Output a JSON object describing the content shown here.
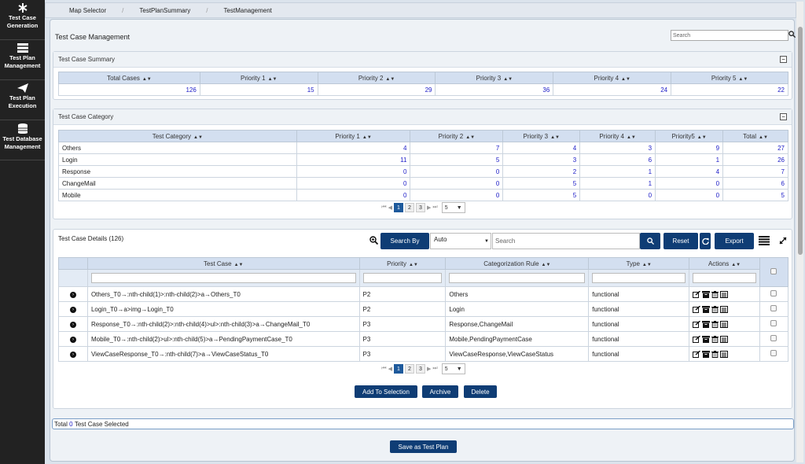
{
  "sidebar": {
    "items": [
      {
        "label": "Test Case Generation",
        "icon": "asterisk-icon"
      },
      {
        "label": "Test Plan Management",
        "icon": "server-stack-icon"
      },
      {
        "label": "Test Plan Execution",
        "icon": "paper-plane-icon"
      },
      {
        "label": "Test Database Management",
        "icon": "database-icon"
      }
    ]
  },
  "breadcrumb": [
    "Map Selector",
    "TestPlanSummary",
    "TestManagement"
  ],
  "page": {
    "title": "Test Case Management",
    "search_placeholder": "Search"
  },
  "summary": {
    "title": "Test Case Summary",
    "headers": [
      "Total Cases",
      "Priority 1",
      "Priority 2",
      "Priority 3",
      "Priority 4",
      "Priority 5"
    ],
    "values": [
      "126",
      "15",
      "29",
      "36",
      "24",
      "22"
    ]
  },
  "category": {
    "title": "Test Case Category",
    "headers": [
      "Test Category",
      "Priority 1",
      "Priority 2",
      "Priority 3",
      "Priority 4",
      "Priority5",
      "Total"
    ],
    "rows": [
      [
        "Others",
        "4",
        "7",
        "4",
        "3",
        "9",
        "27"
      ],
      [
        "Login",
        "11",
        "5",
        "3",
        "6",
        "1",
        "26"
      ],
      [
        "Response",
        "0",
        "0",
        "2",
        "1",
        "4",
        "7"
      ],
      [
        "ChangeMail",
        "0",
        "0",
        "5",
        "1",
        "0",
        "6"
      ],
      [
        "Mobile",
        "0",
        "0",
        "5",
        "0",
        "0",
        "5"
      ]
    ],
    "pager": {
      "pages": [
        "1",
        "2",
        "3"
      ],
      "page_size": "5"
    }
  },
  "details": {
    "title": "Test Case Details (126)",
    "search_by_label": "Search By",
    "search_by_value": "Auto",
    "search_placeholder": "Search",
    "reset_label": "Reset",
    "export_label": "Export",
    "headers": [
      "Test Case",
      "Priority",
      "Categorization Rule",
      "Type",
      "Actions"
    ],
    "rows": [
      [
        "Others_T0→:nth-child(1)>:nth-child(2)>a→Others_T0",
        "P2",
        "Others",
        "functional"
      ],
      [
        "Login_T0→a>img→Login_T0",
        "P2",
        "Login",
        "functional"
      ],
      [
        "Response_T0→:nth-child(2)>:nth-child(4)>ul>:nth-child(3)>a→ChangeMail_T0",
        "P3",
        "Response,ChangeMail",
        "functional"
      ],
      [
        "Mobile_T0→:nth-child(2)>ul>:nth-child(5)>a→PendingPaymentCase_T0",
        "P3",
        "Mobile,PendingPaymentCase",
        "functional"
      ],
      [
        "ViewCaseResponse_T0→:nth-child(7)>a→ViewCaseStatus_T0",
        "P3",
        "ViewCaseResponse,ViewCaseStatus",
        "functional"
      ]
    ],
    "pager": {
      "pages": [
        "1",
        "2",
        "3"
      ],
      "page_size": "5"
    },
    "buttons": {
      "add": "Add To Selection",
      "archive": "Archive",
      "delete": "Delete"
    }
  },
  "status": {
    "prefix": "Total",
    "count": "0",
    "suffix": "Test Case Selected"
  },
  "save_label": "Save as Test Plan",
  "colors": {
    "sidebar": "#222222",
    "primary_button": "#0f3d75",
    "header_cell": "#d3dff0",
    "number_text": "#2020c8"
  }
}
